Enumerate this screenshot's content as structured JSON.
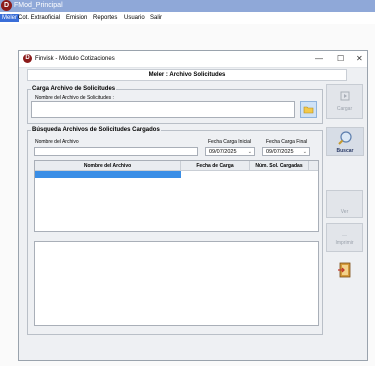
{
  "app": {
    "logo_letter": "D",
    "title": "FMod_Principal",
    "menu": [
      "Meler",
      "Cot. Extraoficial",
      "Emision",
      "Reportes",
      "Usuario",
      "Salir"
    ]
  },
  "window": {
    "logo_letter": "D",
    "title": "Finvisk - Módulo Cotizaciones",
    "controls": [
      "—",
      "☐",
      "✕"
    ],
    "header": "Meler : Archivo Solicitudes"
  },
  "carga": {
    "legend": "Carga Archivo de Solicitudes",
    "file_label": "Nombre del Archivo de Solicitudes :",
    "file_value": ""
  },
  "busqueda": {
    "legend": "Búsqueda Archivos de Solicitudes Cargados",
    "name_label": "Nombre del Archivo",
    "name_value": "",
    "fecha_inicial_label": "Fecha Carga Inicial",
    "fecha_inicial_value": "09/07/2025",
    "fecha_final_label": "Fecha Carga Final",
    "fecha_final_value": "09/07/2025",
    "columns": [
      "Nombre del Archivo",
      "Fecha de Carga",
      "Núm. Sol. Cargadas"
    ]
  },
  "buttons": {
    "cargar": "Cargar",
    "buscar": "Buscar",
    "ver": "Ver",
    "imprimir": "Imprimir"
  },
  "colors": {
    "selection": "#3a8ee6",
    "logo": "#8b1a1a"
  }
}
